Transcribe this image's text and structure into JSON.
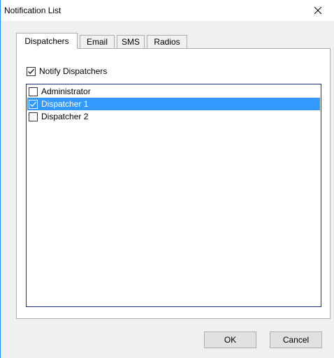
{
  "window": {
    "title": "Notification List",
    "close_glyph": "close-icon"
  },
  "tabs": [
    {
      "label": "Dispatchers",
      "active": true
    },
    {
      "label": "Email",
      "active": false
    },
    {
      "label": "SMS",
      "active": false
    },
    {
      "label": "Radios",
      "active": false
    }
  ],
  "notify": {
    "label": "Notify Dispatchers",
    "checked": true
  },
  "list": {
    "items": [
      {
        "label": "Administrator",
        "checked": false,
        "selected": false
      },
      {
        "label": "Dispatcher 1",
        "checked": true,
        "selected": true
      },
      {
        "label": "Dispatcher 2",
        "checked": false,
        "selected": false
      }
    ]
  },
  "buttons": {
    "ok": "OK",
    "cancel": "Cancel"
  },
  "colors": {
    "selection": "#3399ff",
    "list_border": "#1e2a8a",
    "window_accent": "#1e90ff"
  }
}
